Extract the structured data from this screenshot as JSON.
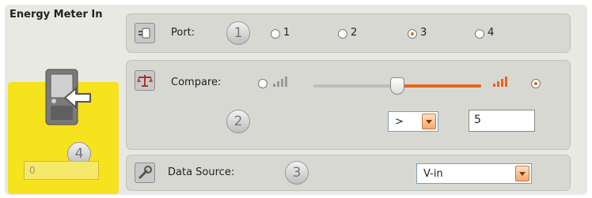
{
  "block": {
    "title": "Energy Meter In",
    "value": "0",
    "badge": "4"
  },
  "port": {
    "label": "Port:",
    "badge": "1",
    "options": [
      "1",
      "2",
      "3",
      "4"
    ],
    "selected": "3"
  },
  "compare": {
    "label": "Compare:",
    "badge": "2",
    "slider_level": 0.5,
    "operator": ">",
    "value": "5"
  },
  "data_source": {
    "label": "Data Source:",
    "badge": "3",
    "value": "V-in"
  },
  "colors": {
    "accent": "#e8641a",
    "highlight": "#f6e21d",
    "panel": "#d8d8d3"
  },
  "icons": {
    "port": "plug-icon",
    "compare": "scale-icon",
    "data_source": "wrench-icon",
    "block": "energy-meter-icon"
  }
}
